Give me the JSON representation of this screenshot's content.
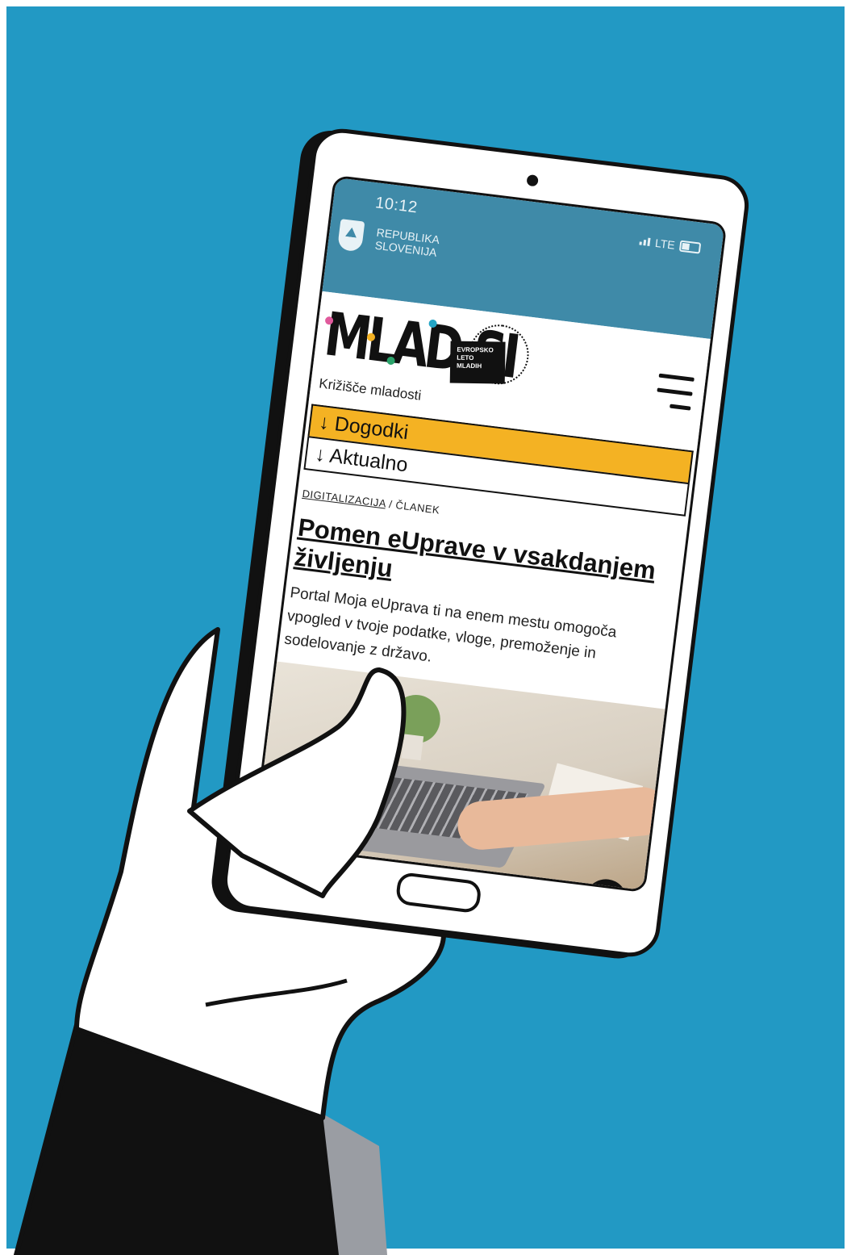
{
  "colors": {
    "background": "#2299c4",
    "accent_yellow": "#f4b223",
    "gov_bar": "#3f8aa8"
  },
  "status_bar": {
    "time": "10:12",
    "network": "LTE"
  },
  "gov_header": {
    "line1": "REPUBLIKA",
    "line2": "SLOVENIJA"
  },
  "site": {
    "logo": "MLAD.SI",
    "tagline": "Križišče mladosti",
    "eyl_badge": [
      "EVROPSKO",
      "LETO",
      "MLADIH"
    ]
  },
  "menu": [
    {
      "label": "Dogodki",
      "arrow": "↓",
      "active": true
    },
    {
      "label": "Aktualno",
      "arrow": "↓",
      "active": false
    }
  ],
  "breadcrumb": {
    "category": "DIGITALIZACIJA",
    "separator": "/",
    "type": "ČLANEK"
  },
  "article": {
    "title": "Pomen eUprave v vsakdanjem življenju",
    "lead": "Portal Moja eUprava ti na enem mestu omogoča vpogled v tvoje podatke, vloge, premoženje in sodelovanje z državo."
  },
  "icons": {
    "menu": "hamburger-icon",
    "to_top": "arrow-up-icon",
    "crest": "slovenia-crest-icon"
  }
}
